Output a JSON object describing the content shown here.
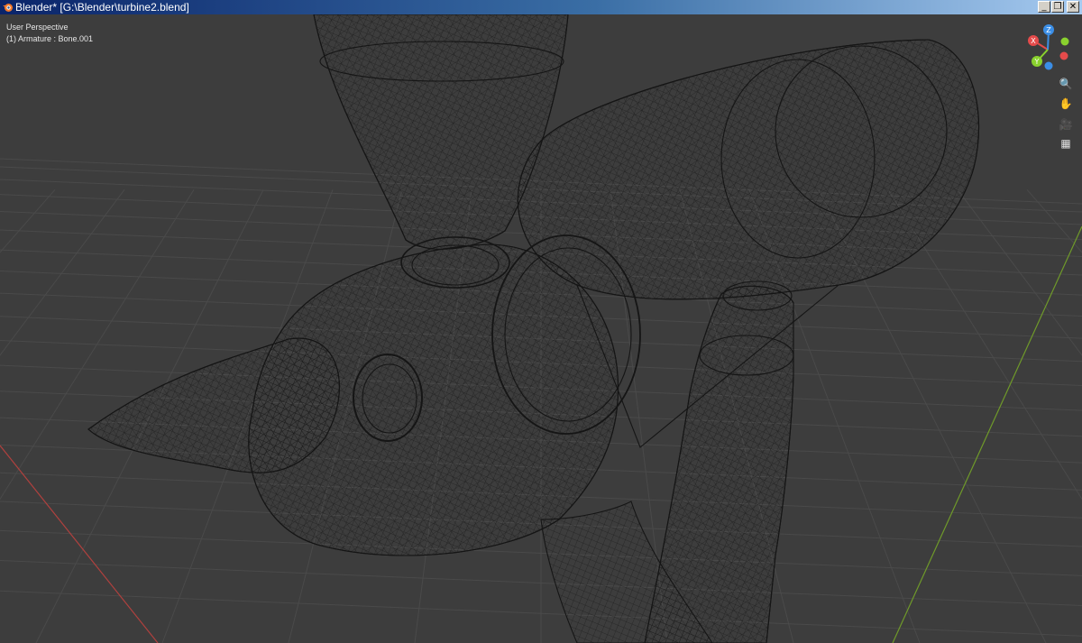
{
  "window": {
    "title": "Blender* [G:\\Blender\\turbine2.blend]",
    "controls": {
      "minimize": "_",
      "maximize": "❐",
      "close": "✕"
    }
  },
  "viewport": {
    "view_name": "User Perspective",
    "active_object": "(1) Armature : Bone.001",
    "shading": "wireframe",
    "colors": {
      "background": "#3d3d3d",
      "grid": "#4a4a4a",
      "x_axis": "#b0413e",
      "y_axis": "#6f9a2a",
      "wire": "#151515"
    }
  },
  "navigation_gizmo": {
    "axes": {
      "x": "X",
      "y": "Y",
      "z": "Z"
    },
    "colors": {
      "x": "#e54b4b",
      "y": "#8ad22e",
      "z": "#3b8ee6"
    }
  },
  "navigation_buttons": [
    {
      "icon": "zoom-icon",
      "glyph": "🔍"
    },
    {
      "icon": "hand-icon",
      "glyph": "✋"
    },
    {
      "icon": "camera-icon",
      "glyph": "🎥"
    },
    {
      "icon": "grid-icon",
      "glyph": "▦"
    }
  ]
}
